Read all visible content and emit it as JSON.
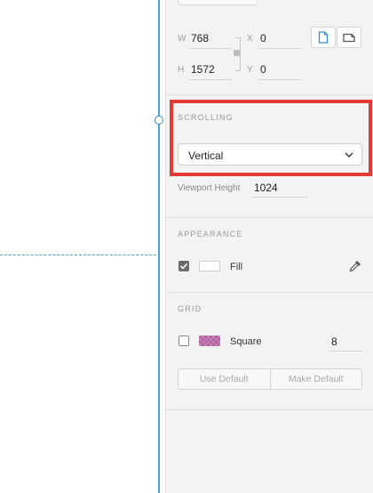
{
  "dimensions": {
    "w_label": "W",
    "w_value": "768",
    "h_label": "H",
    "h_value": "1572",
    "x_label": "X",
    "x_value": "0",
    "y_label": "Y",
    "y_value": "0"
  },
  "scrolling": {
    "label": "SCROLLING",
    "selected": "Vertical",
    "viewport_label": "Viewport Height",
    "viewport_value": "1024"
  },
  "appearance": {
    "label": "APPEARANCE",
    "fill_label": "Fill",
    "fill_checked": true,
    "fill_color": "#ffffff"
  },
  "grid": {
    "label": "GRID",
    "type_label": "Square",
    "checked": false,
    "size": "8",
    "use_default": "Use Default",
    "make_default": "Make Default"
  },
  "colors": {
    "accent": "#4aa3e0",
    "highlight": "#e53935",
    "grid_swatch": "#c97bb7"
  },
  "icons": [
    "portrait-icon",
    "landscape-icon",
    "lock-icon",
    "chevron-down-icon",
    "eyedropper-icon",
    "checkmark-icon"
  ]
}
